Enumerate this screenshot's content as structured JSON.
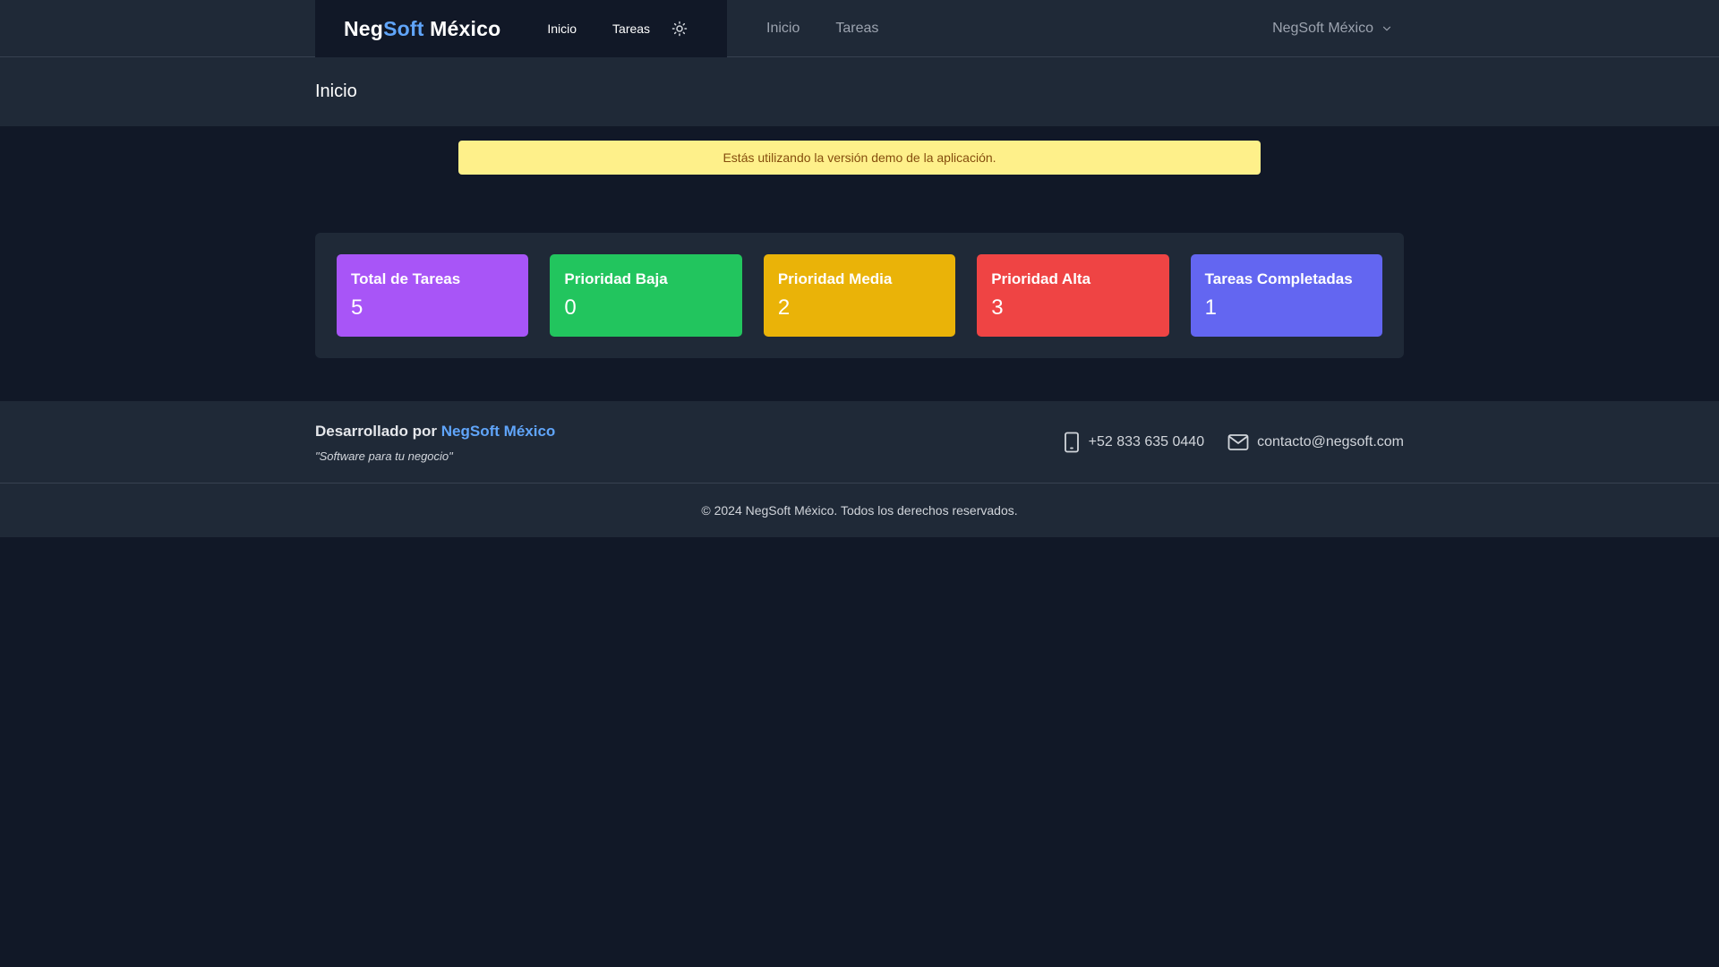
{
  "brand": {
    "part1": "Neg",
    "part2": "Soft",
    "part3": " México"
  },
  "brand_nav": [
    {
      "label": "Inicio"
    },
    {
      "label": "Tareas"
    }
  ],
  "main_nav": [
    {
      "label": "Inicio"
    },
    {
      "label": "Tareas"
    }
  ],
  "theme_toggle_icon": "sun-icon",
  "user_menu": {
    "label": "NegSoft México",
    "icon": "chevron-down-icon"
  },
  "page": {
    "title": "Inicio"
  },
  "alert": {
    "text": "Estás utilizando la versión demo de la aplicación."
  },
  "stats": [
    {
      "label": "Total de Tareas",
      "value": "5",
      "color": "#a855f7"
    },
    {
      "label": "Prioridad Baja",
      "value": "0",
      "color": "#22c55e"
    },
    {
      "label": "Prioridad Media",
      "value": "2",
      "color": "#eab308"
    },
    {
      "label": "Prioridad Alta",
      "value": "3",
      "color": "#ef4444"
    },
    {
      "label": "Tareas Completadas",
      "value": "1",
      "color": "#6366f1"
    }
  ],
  "footer": {
    "developed_by": "Desarrollado por",
    "company_link": "NegSoft México",
    "tagline": "\"Software para tu negocio\"",
    "phone": "+52 833 635 0440",
    "email": "contacto@negsoft.com",
    "copyright": "© 2024 NegSoft México. Todos los derechos reservados."
  },
  "colors": {
    "accent": "#60a5fa",
    "background": "#111827",
    "surface": "#1f2937",
    "alert_bg": "#fef08a"
  }
}
